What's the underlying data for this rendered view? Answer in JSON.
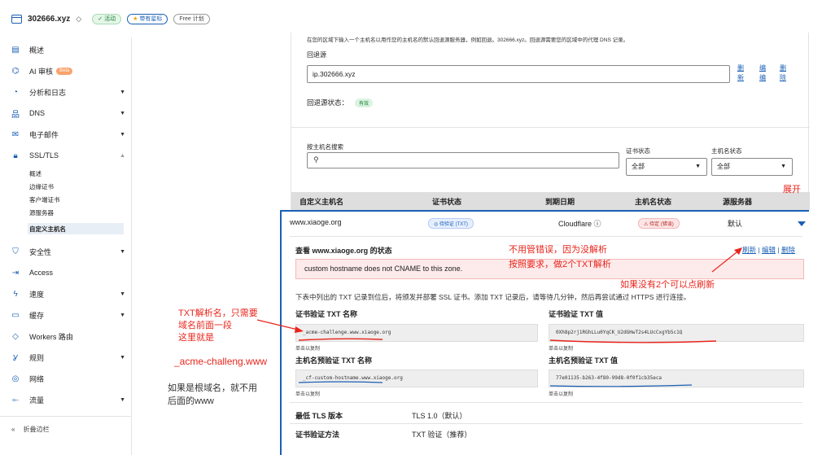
{
  "header": {
    "site": "302666.xyz",
    "chevron": "◇",
    "badge_active": "活动",
    "badge_star": "带有星标",
    "badge_plan": "Free 计划"
  },
  "sidebar": {
    "items": [
      {
        "label": "概述",
        "icon": "doc-icon"
      },
      {
        "label": "AI 审核",
        "icon": "ai-icon",
        "badge": "Beta"
      },
      {
        "label": "分析和日志",
        "icon": "chart-icon",
        "arrow": "▼"
      },
      {
        "label": "DNS",
        "icon": "dns-icon",
        "arrow": "▼"
      },
      {
        "label": "电子邮件",
        "icon": "mail-icon",
        "arrow": "▼"
      },
      {
        "label": "SSL/TLS",
        "icon": "lock-icon",
        "arrow": "▲"
      },
      {
        "label": "安全性",
        "icon": "shield-icon",
        "arrow": "▼"
      },
      {
        "label": "Access",
        "icon": "access-icon"
      },
      {
        "label": "速度",
        "icon": "bolt-icon",
        "arrow": "▼"
      },
      {
        "label": "缓存",
        "icon": "cache-icon",
        "arrow": "▼"
      },
      {
        "label": "Workers 路由",
        "icon": "workers-icon"
      },
      {
        "label": "规则",
        "icon": "rules-icon",
        "arrow": "▼"
      },
      {
        "label": "网络",
        "icon": "network-icon"
      },
      {
        "label": "流量",
        "icon": "traffic-icon",
        "arrow": "▼"
      }
    ],
    "ssl_sub": [
      "概述",
      "边缘证书",
      "客户端证书",
      "源服务器",
      "自定义主机名"
    ],
    "collapse": "折叠边栏"
  },
  "origin": {
    "intro": "在您的区域下输入一个主机名以用作您的主机名的默认回退源服务器，例如回退。302666.xyz。回退源需要您的区域中的代理 DNS 记录。",
    "label": "回退源",
    "value": "ip.302666.xyz",
    "links": [
      "删除",
      "编辑",
      "删除"
    ],
    "link_parts": [
      [
        "删",
        "新"
      ],
      [
        "编",
        "编"
      ],
      [
        "删",
        "除"
      ]
    ],
    "status_label": "回退源状态：",
    "status_value": "有效"
  },
  "filters": {
    "search_label": "按主机名搜索",
    "search_icon": "🔍",
    "cert_status_label": "证书状态",
    "cert_status_value": "全部",
    "host_status_label": "主机名状态",
    "host_status_value": "全部"
  },
  "table": {
    "headers": [
      "自定义主机名",
      "证书状态",
      "到期日期",
      "主机名状态",
      "源服务器"
    ],
    "row": {
      "hostname": "www.xiaoge.org",
      "cert_status": "◎ 待验证 (TXT)",
      "expiry": "Cloudflare ⓘ",
      "host_status": "⚠ 待定 (错误)",
      "origin": "默认"
    }
  },
  "details": {
    "title": "查看 www.xiaoge.org 的状态",
    "links": {
      "refresh": "刷新",
      "edit": "编辑",
      "delete": "删除",
      "sep": "|"
    },
    "error": "custom hostname does not CNAME to this zone.",
    "hint": "下表中列出的 TXT 记录到位后，将颁发并部署 SSL 证书。添加 TXT 记录后，请等待几分钟，然后再尝试通过 HTTPS 进行连接。",
    "cert_txt_name_label": "证书验证 TXT 名称",
    "cert_txt_name": "_acme-challenge.www.xiaoge.org",
    "cert_txt_value_label": "证书验证 TXT 值",
    "cert_txt_value": "0Xh8p2rj1RGhLLu0YqCK_U2dGHwT2s4LUcCxgYb5c1Q",
    "pre_txt_name_label": "主机名预验证 TXT 名称",
    "pre_txt_name": "_cf-custom-hostname.www.xiaoge.org",
    "pre_txt_value_label": "主机名预验证 TXT 值",
    "pre_txt_value": "77e01135-b263-4f80-99d8-0f0f1cb35eca",
    "copy_hint": "单击以复制",
    "min_tls_label": "最低 TLS 版本",
    "min_tls_value": "TLS 1.0（默认）",
    "method_label": "证书验证方法",
    "method_value": "TXT 验证（推荐）"
  },
  "annotations": {
    "expand": "展开",
    "ignore1": "不用管错误，因为没解析",
    "ignore2": "按照要求，做2个TXT解析",
    "refresh_hint": "如果没有2个可以点刷新",
    "txt1": "TXT解析名，只需要",
    "txt2": "域名前面一段",
    "txt3": "这里就是",
    "txt4": "_acme-challeng.www",
    "root1": "如果是根域名，就不用",
    "root2": "后面的www"
  },
  "colors": {
    "accent": "#1a5fb4",
    "annotation": "#e8251c"
  }
}
